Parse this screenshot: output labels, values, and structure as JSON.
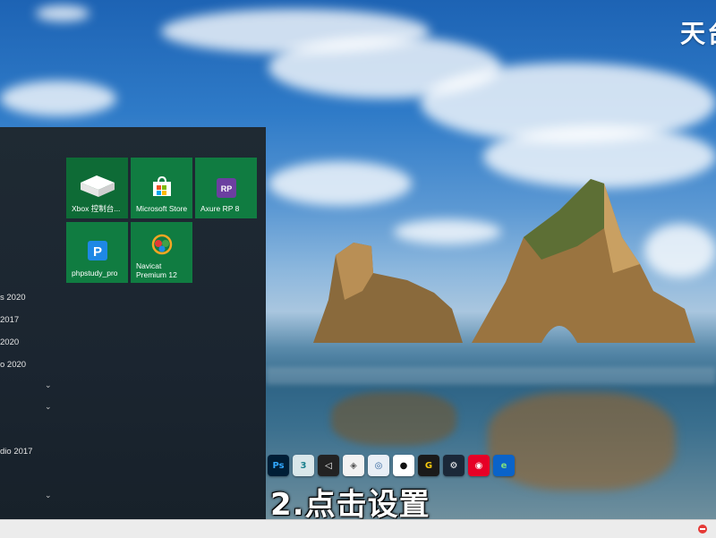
{
  "brand": {
    "text": "天台"
  },
  "tiles": [
    {
      "label": "Xbox 控制台...",
      "icon": "xbox-console-icon",
      "color": "#0e6b36"
    },
    {
      "label": "Microsoft Store",
      "icon": "store-icon",
      "color": "#107c41"
    },
    {
      "label": "Axure RP 8",
      "icon": "axure-rp-icon",
      "color": "#107c41"
    },
    {
      "label": "phpstudy_pro",
      "icon": "phpstudy-icon",
      "color": "#107c41"
    },
    {
      "label": "Navicat Premium 12",
      "label_line1": "Navicat",
      "label_line2": "Premium 12",
      "icon": "navicat-icon",
      "color": "#107c41"
    }
  ],
  "app_list": [
    {
      "text": "s 2020"
    },
    {
      "text": " 2017"
    },
    {
      "text": "2020"
    },
    {
      "text": "o 2020"
    },
    {
      "text": "dio 2017"
    }
  ],
  "dock": [
    {
      "name": "photoshop-icon",
      "label": "Ps",
      "bg": "#001e36",
      "fg": "#31a8ff"
    },
    {
      "name": "3dsmax-icon",
      "label": "3",
      "bg": "#d9e7ea",
      "fg": "#1a7f8c"
    },
    {
      "name": "unity-icon",
      "label": "◁",
      "bg": "#222222",
      "fg": "#ffffff"
    },
    {
      "name": "drop-app-icon",
      "label": "◈",
      "bg": "#f2f2f2",
      "fg": "#555555"
    },
    {
      "name": "globe-app-icon",
      "label": "◎",
      "bg": "#e8eef5",
      "fg": "#2b5f9a"
    },
    {
      "name": "qq-icon",
      "label": "●",
      "bg": "#ffffff",
      "fg": "#111111"
    },
    {
      "name": "g-app-icon",
      "label": "G",
      "bg": "#1a1a1a",
      "fg": "#f6c90e"
    },
    {
      "name": "steam-icon",
      "label": "⚙",
      "bg": "#1b2838",
      "fg": "#ffffff"
    },
    {
      "name": "netease-music-icon",
      "label": "◉",
      "bg": "#e60026",
      "fg": "#ffffff"
    },
    {
      "name": "edge-icon",
      "label": "e",
      "bg": "#0a63c9",
      "fg": "#7fe07f"
    }
  ],
  "caption": {
    "text": "2.点击设置"
  }
}
